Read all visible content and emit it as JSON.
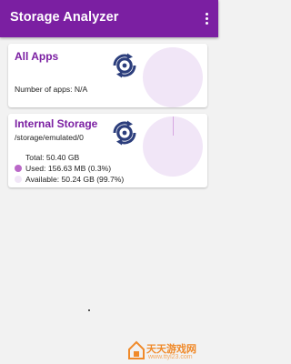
{
  "appbar": {
    "title": "Storage Analyzer",
    "background": "#7b1fa2",
    "menu_icon": "more-vert-icon"
  },
  "apps_card": {
    "title": "All Apps",
    "count_text": "Number of apps: N/A",
    "refresh_icon": "refresh-icon",
    "pie": {
      "used_fraction": 0
    }
  },
  "storage_card": {
    "title": "Internal Storage",
    "path": "/storage/emulated/0",
    "total": "Total: 50.40 GB",
    "used": "Used: 156.63 MB (0.3%)",
    "available": "Available: 50.24 GB (99.7%)",
    "refresh_icon": "refresh-icon",
    "colors": {
      "used": "#ba68c8",
      "available": "#f1e6f7"
    },
    "pie": {
      "used_fraction": 0.003
    }
  },
  "watermark": {
    "text": "天天游戏网",
    "url": "www.ttyl23.com"
  }
}
